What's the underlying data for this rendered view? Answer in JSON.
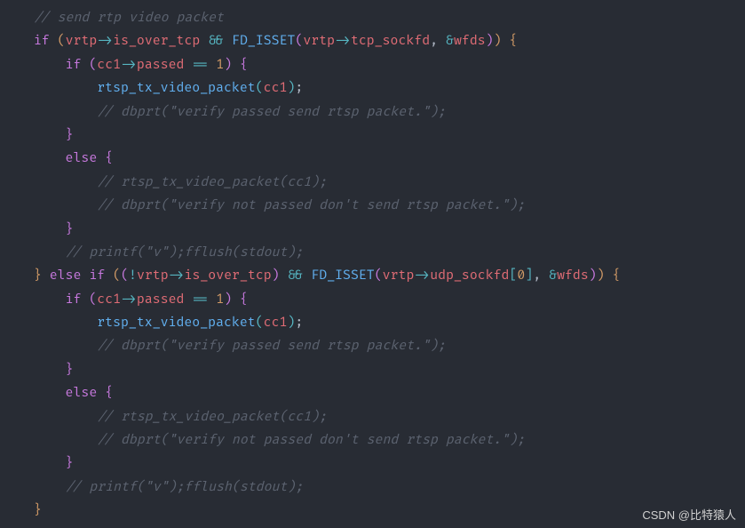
{
  "code": {
    "comment_send": "// send rtp video packet",
    "kw_if": "if",
    "kw_else": "else",
    "kw_else_if": "else if",
    "var_vrtp": "vrtp",
    "arrow": "->",
    "prop_is_over_tcp": "is_over_tcp",
    "op_and": "&&",
    "op_not": "!",
    "op_eq": "==",
    "op_amp": "&",
    "fn_fd_isset": "FD_ISSET",
    "prop_tcp_sockfd": "tcp_sockfd",
    "prop_udp_sockfd": "udp_sockfd",
    "var_wfds": "wfds",
    "var_cc1": "cc1",
    "prop_passed": "passed",
    "num_1": "1",
    "num_0": "0",
    "fn_rtsp_tx": "rtsp_tx_video_packet",
    "comment_verify_passed": "// dbprt(\"verify passed send rtsp packet.\");",
    "comment_rtsp_tx": "// rtsp_tx_video_packet(cc1);",
    "comment_verify_not_passed": "// dbprt(\"verify not passed don't send rtsp packet.\");",
    "comment_printf": "// printf(\"v\");fflush(stdout);",
    "watermark": "CSDN @比特猿人"
  }
}
